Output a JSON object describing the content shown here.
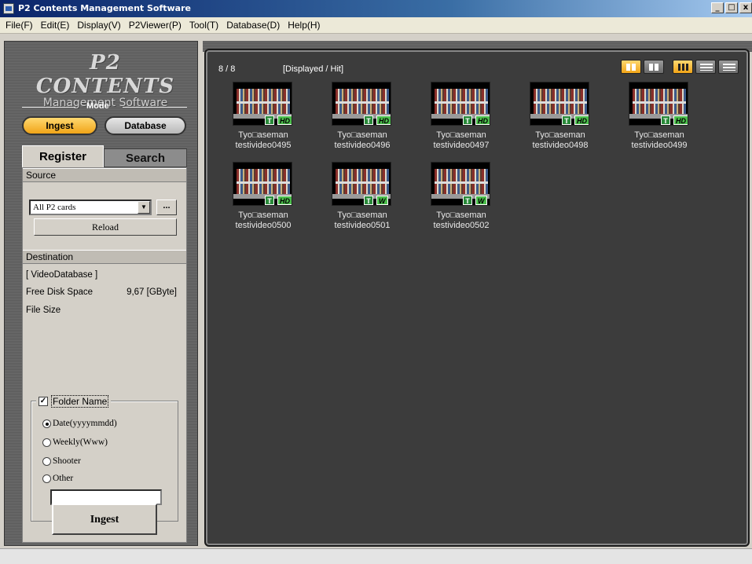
{
  "window": {
    "title": "P2 Contents Management Software",
    "controls": [
      "_",
      "□",
      "x"
    ]
  },
  "menu": [
    "File(F)",
    "Edit(E)",
    "Display(V)",
    "P2Viewer(P)",
    "Tool(T)",
    "Database(D)",
    "Help(H)"
  ],
  "logo": {
    "main": "P2 CONTENTS",
    "sub": "Management Software"
  },
  "mode": {
    "label": "Mode",
    "ingest": "Ingest",
    "database": "Database"
  },
  "tabs": {
    "register": "Register",
    "search": "Search"
  },
  "source": {
    "header": "Source",
    "selected": "All P2 cards",
    "browse": "...",
    "reload": "Reload"
  },
  "destination": {
    "header": "Destination",
    "database": "[ VideoDatabase ]",
    "free_disk_label": "Free Disk Space",
    "free_disk_value": "9,67 [GByte]",
    "file_size_label": "File Size"
  },
  "folder": {
    "label": "Folder Name",
    "checked": true,
    "options": [
      "Date(yyyymmdd)",
      "Weekly(Www)",
      "Shooter",
      "Other"
    ],
    "selected_index": 0,
    "other_value": ""
  },
  "ingest_button": "Ingest",
  "browser": {
    "count": "8 / 8",
    "hit_label": "[Displayed / Hit]",
    "thumbnails": [
      {
        "line1": "Tyo□aseman",
        "line2": "testivideo0495",
        "badge": "HD"
      },
      {
        "line1": "Tyo□aseman",
        "line2": "testivideo0496",
        "badge": "HD"
      },
      {
        "line1": "Tyo□aseman",
        "line2": "testivideo0497",
        "badge": "HD"
      },
      {
        "line1": "Tyo□aseman",
        "line2": "testivideo0498",
        "badge": "HD"
      },
      {
        "line1": "Tyo□aseman",
        "line2": "testivideo0499",
        "badge": "HD"
      },
      {
        "line1": "Tyo□aseman",
        "line2": "testivideo0500",
        "badge": "HD"
      },
      {
        "line1": "Tyo□aseman",
        "line2": "testivideo0501",
        "badge": "W"
      },
      {
        "line1": "Tyo□aseman",
        "line2": "testivideo0502",
        "badge": "W"
      }
    ]
  },
  "colors": {
    "accent": "#f0a418",
    "panel_dark": "#3c3c3c",
    "hd_badge": "#4cbf4c"
  }
}
